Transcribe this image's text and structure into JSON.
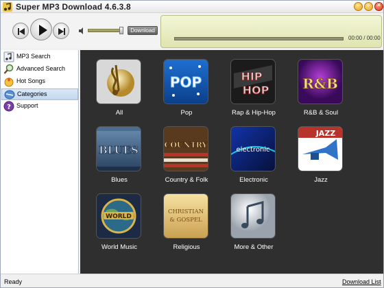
{
  "window": {
    "title": "Super MP3 Download  4.6.3.8"
  },
  "player": {
    "download_label": "Download",
    "time": "00:00 / 00:00"
  },
  "sidebar": {
    "items": [
      {
        "label": "MP3 Search",
        "icon": "music-note-icon"
      },
      {
        "label": "Advanced Search",
        "icon": "magnifier-icon"
      },
      {
        "label": "Hot Songs",
        "icon": "hot-icon"
      },
      {
        "label": "Categories",
        "icon": "categories-icon",
        "active": true
      },
      {
        "label": "Support",
        "icon": "help-icon"
      }
    ]
  },
  "categories": [
    {
      "label": "All",
      "icon": "gold-music-note-icon"
    },
    {
      "label": "Pop",
      "icon": "pop-badge-icon"
    },
    {
      "label": "Rap & Hip-Hop",
      "icon": "hip-hop-badge-icon"
    },
    {
      "label": "R&B & Soul",
      "icon": "rnb-badge-icon"
    },
    {
      "label": "Blues",
      "icon": "blues-badge-icon"
    },
    {
      "label": "Country & Folk",
      "icon": "country-badge-icon"
    },
    {
      "label": "Electronic",
      "icon": "electronic-badge-icon"
    },
    {
      "label": "Jazz",
      "icon": "jazz-trumpet-icon"
    },
    {
      "label": "World Music",
      "icon": "world-globe-icon"
    },
    {
      "label": "Religious",
      "icon": "christian-gospel-icon"
    },
    {
      "label": "More & Other",
      "icon": "silver-music-note-icon"
    }
  ],
  "art_text": {
    "pop": "POP",
    "hiphop_1": "HIP",
    "hiphop_2": "HOP",
    "rnb": "R&B",
    "blues": "BLUES",
    "country": "COUNTRY",
    "electronic": "electronic",
    "jazz": "JAZZ",
    "world": "WORLD",
    "religious_1": "CHRISTIAN",
    "religious_2": "& GOSPEL"
  },
  "status": {
    "text": "Ready",
    "download_list": "Download List"
  },
  "colors": {
    "content_bg": "#2f2f2f",
    "display_bg": "#e9edc4",
    "active_item": "#c9dcf2"
  }
}
